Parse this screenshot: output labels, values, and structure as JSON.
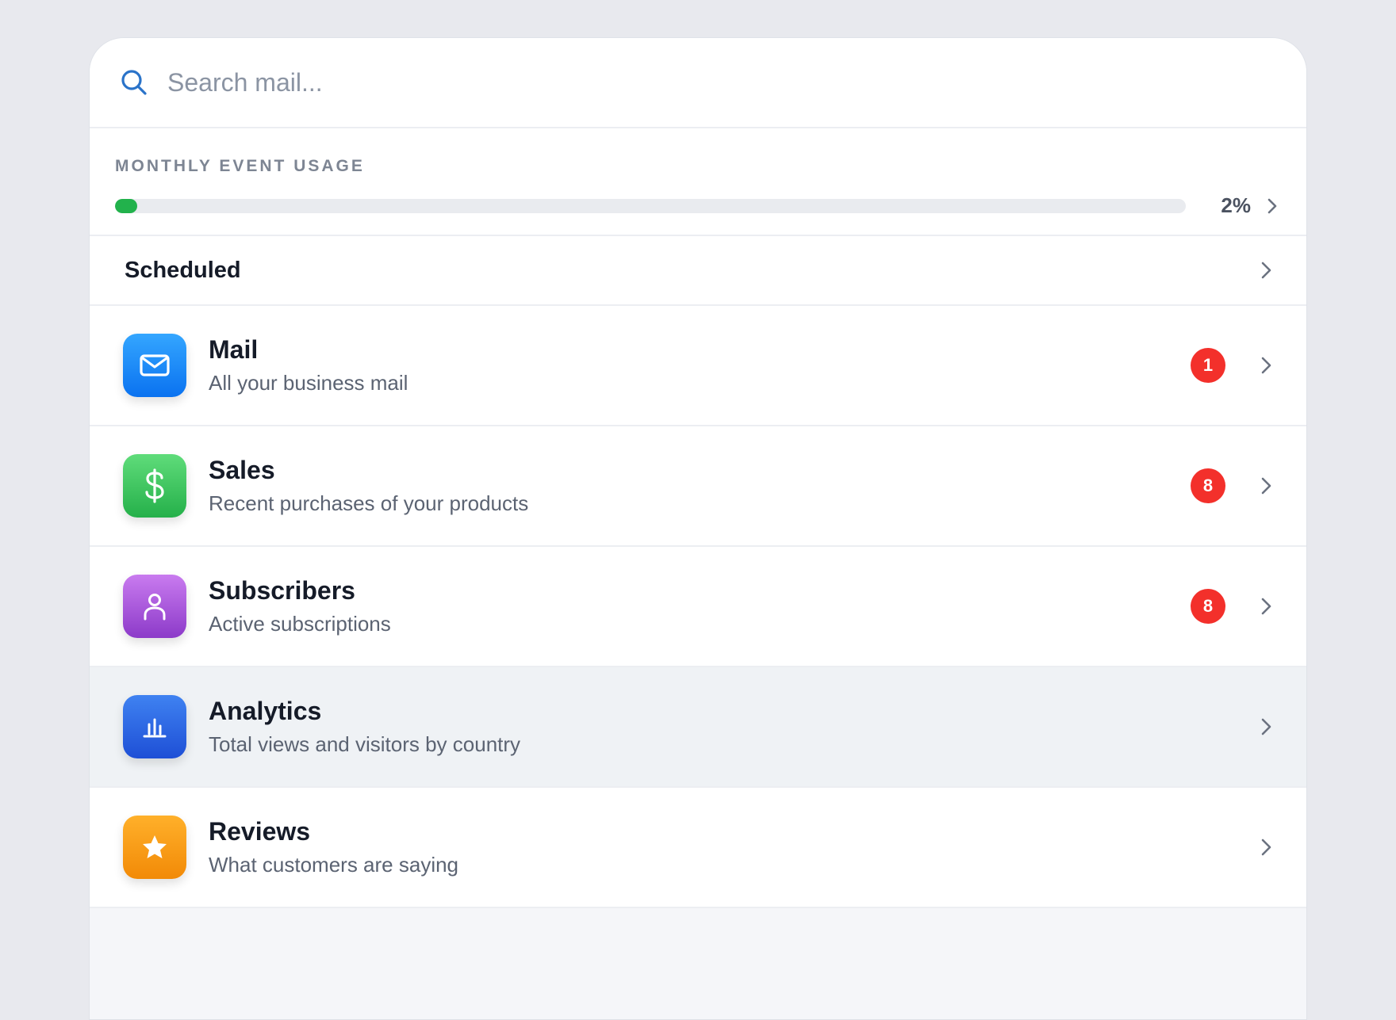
{
  "search": {
    "placeholder": "Search mail...",
    "value": ""
  },
  "usage": {
    "title": "MONTHLY EVENT USAGE",
    "percent_label": "2%",
    "progress_fraction": 0.02,
    "fill_color": "#22b24c"
  },
  "scheduled": {
    "label": "Scheduled"
  },
  "items": [
    {
      "title": "Mail",
      "subtitle": "All your business mail",
      "badge": "1",
      "icon": "mail-icon",
      "color_from": "#34a6ff",
      "color_to": "#0a72f0"
    },
    {
      "title": "Sales",
      "subtitle": "Recent purchases of your products",
      "badge": "8",
      "icon": "dollar-icon",
      "color_from": "#5fdc7a",
      "color_to": "#25b04a"
    },
    {
      "title": "Subscribers",
      "subtitle": "Active subscriptions",
      "badge": "8",
      "icon": "user-icon",
      "color_from": "#c97bef",
      "color_to": "#8c3ac9"
    },
    {
      "title": "Analytics",
      "subtitle": "Total views and visitors by country",
      "badge": "",
      "icon": "bar-chart-icon",
      "color_from": "#3f82f1",
      "color_to": "#1e4fd6"
    },
    {
      "title": "Reviews",
      "subtitle": "What customers are saying",
      "badge": "",
      "icon": "star-icon",
      "color_from": "#ffb02a",
      "color_to": "#f28a07"
    }
  ],
  "badge_color": "#f3302b"
}
